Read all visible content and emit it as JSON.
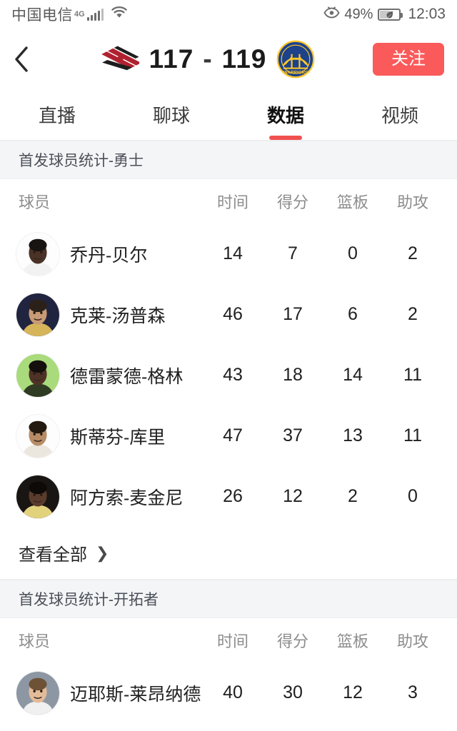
{
  "status_bar": {
    "carrier": "中国电信",
    "network_type": "4G",
    "signal_icon": "signal-bars-icon",
    "wifi_icon": "wifi-icon",
    "eye_comfort_icon": "eye-comfort-icon",
    "battery_percent": "49%",
    "battery_icon": "battery-saver-leaf-icon",
    "time": "12:03"
  },
  "header": {
    "back_icon": "chevron-left-icon",
    "home_team": {
      "name": "开拓者",
      "logo_icon": "trail-blazers-logo",
      "score": "117"
    },
    "away_team": {
      "name": "勇士",
      "logo_icon": "warriors-logo",
      "score": "119"
    },
    "score_separator": "-",
    "follow_label": "关注",
    "follow_color": "#fa5a5a"
  },
  "tabs": [
    {
      "label": "直播",
      "active": false
    },
    {
      "label": "聊球",
      "active": false
    },
    {
      "label": "数据",
      "active": true
    },
    {
      "label": "视频",
      "active": false
    }
  ],
  "tab_accent_color": "#f0504e",
  "columns": [
    "球员",
    "时间",
    "得分",
    "篮板",
    "助攻"
  ],
  "sections": [
    {
      "title": "首发球员统计-勇士",
      "players": [
        {
          "name": "乔丹-贝尔",
          "avatar_bg": "#fdfdfd",
          "skin": "#4a3226",
          "hair": "#181411",
          "jersey": "#f2f2f2",
          "time": "14",
          "points": "7",
          "rebounds": "0",
          "assists": "2"
        },
        {
          "name": "克莱-汤普森",
          "avatar_bg": "#21243f",
          "skin": "#c99a76",
          "hair": "#2b2118",
          "jersey": "#d6b45a",
          "time": "46",
          "points": "17",
          "rebounds": "6",
          "assists": "2"
        },
        {
          "name": "德雷蒙德-格林",
          "avatar_bg": "#a9da7c",
          "skin": "#4e3225",
          "hair": "#140f0c",
          "jersey": "#2f3b22",
          "time": "43",
          "points": "18",
          "rebounds": "14",
          "assists": "11"
        },
        {
          "name": "斯蒂芬-库里",
          "avatar_bg": "#fdfdfd",
          "skin": "#b78c66",
          "hair": "#241a12",
          "jersey": "#ece7de",
          "time": "47",
          "points": "37",
          "rebounds": "13",
          "assists": "11"
        },
        {
          "name": "阿方索-麦金尼",
          "avatar_bg": "#191513",
          "skin": "#5a3c2c",
          "hair": "#0d0a08",
          "jersey": "#e3d27c",
          "time": "26",
          "points": "12",
          "rebounds": "2",
          "assists": "0"
        }
      ],
      "view_all_label": "查看全部",
      "view_all_icon": "chevron-right-icon"
    },
    {
      "title": "首发球员统计-开拓者",
      "players": [
        {
          "name": "迈耶斯-莱昂纳德",
          "avatar_bg": "#8d97a3",
          "skin": "#e3bb98",
          "hair": "#6d5236",
          "jersey": "#f0f0f0",
          "time": "40",
          "points": "30",
          "rebounds": "12",
          "assists": "3"
        }
      ]
    }
  ]
}
